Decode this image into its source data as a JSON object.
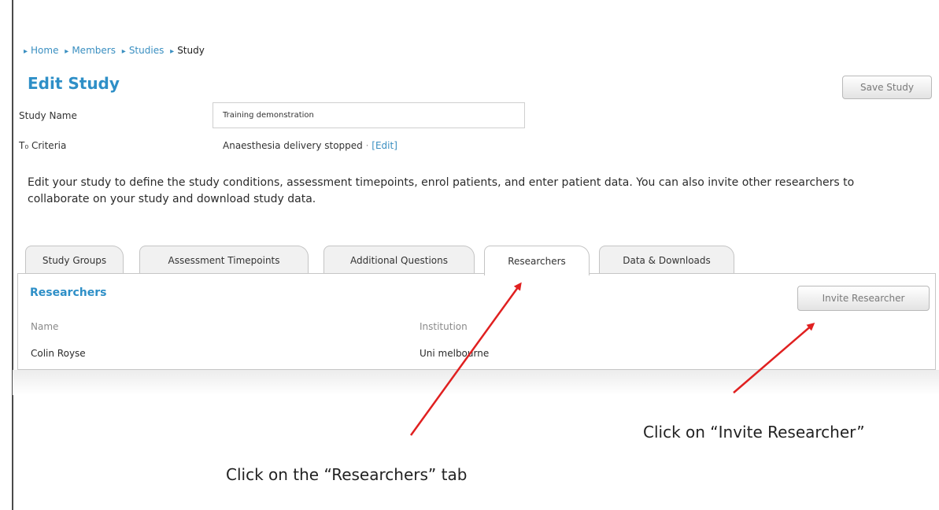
{
  "breadcrumb": {
    "items": [
      "Home",
      "Members",
      "Studies"
    ],
    "current": "Study",
    "separator": "▸"
  },
  "page": {
    "title": "Edit Study",
    "save_label": "Save Study"
  },
  "fields": {
    "study_name_label": "Study Name",
    "study_name_value": "Training demonstration",
    "criteria_label": "T₀ Criteria",
    "criteria_value": "Anaesthesia delivery stopped",
    "criteria_separator": "·",
    "criteria_edit": "[Edit]"
  },
  "description": "Edit your study to define the study conditions, assessment timepoints, enrol patients, and enter patient data. You can also invite other researchers to collaborate on your study and download study data.",
  "tabs": [
    {
      "label": "Study Groups"
    },
    {
      "label": "Assessment Timepoints"
    },
    {
      "label": "Additional Questions"
    },
    {
      "label": "Researchers",
      "active": true
    },
    {
      "label": "Data & Downloads"
    }
  ],
  "panel": {
    "title": "Researchers",
    "invite_label": "Invite Researcher",
    "columns": [
      "Name",
      "Institution"
    ],
    "rows": [
      {
        "name": "Colin Royse",
        "institution": "Uni melbourne"
      }
    ]
  },
  "annotations": {
    "researchers_tab": "Click on the “Researchers” tab",
    "invite_button": "Click on “Invite Researcher”"
  },
  "colors": {
    "accent": "#2e8fc7",
    "link": "#3a8fc1",
    "arrow": "#e02020"
  }
}
